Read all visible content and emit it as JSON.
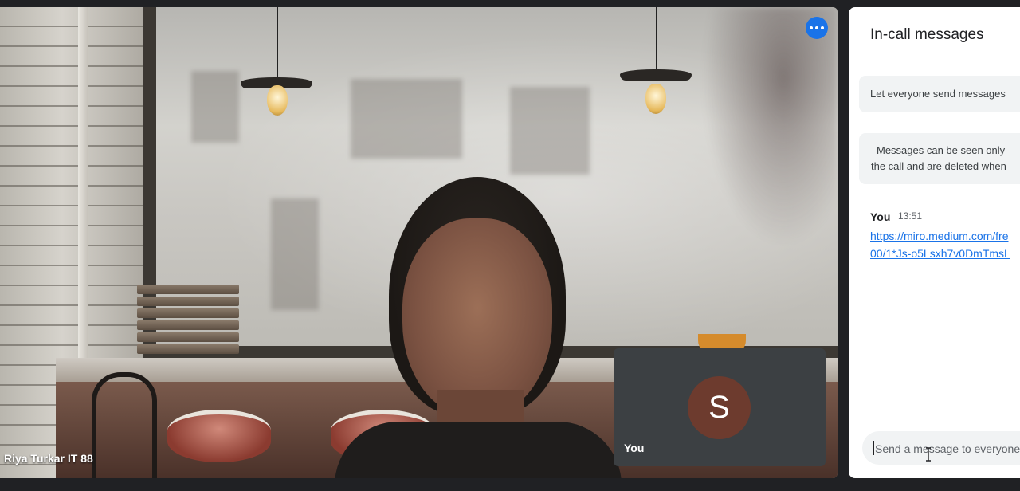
{
  "participant": {
    "name": "Riya Turkar IT 88",
    "more_options_icon": "more-horizontal-icon"
  },
  "self_view": {
    "avatar_initial": "S",
    "label": "You",
    "avatar_color": "#6d3b2e"
  },
  "chat": {
    "title": "In-call messages",
    "toggle_label": "Let everyone send messages",
    "info_line1": "Messages can be seen only",
    "info_line2": "the call and are deleted when",
    "messages": [
      {
        "sender": "You",
        "time": "13:51",
        "link_line1": "https://miro.medium.com/fre",
        "link_line2": "00/1*Js-o5Lsxh7v0DmTmsL"
      }
    ],
    "input_placeholder": "Send a message to everyone"
  },
  "colors": {
    "accent": "#1a73e8",
    "background": "#202124",
    "panel": "#ffffff",
    "tile": "#3c4043"
  }
}
